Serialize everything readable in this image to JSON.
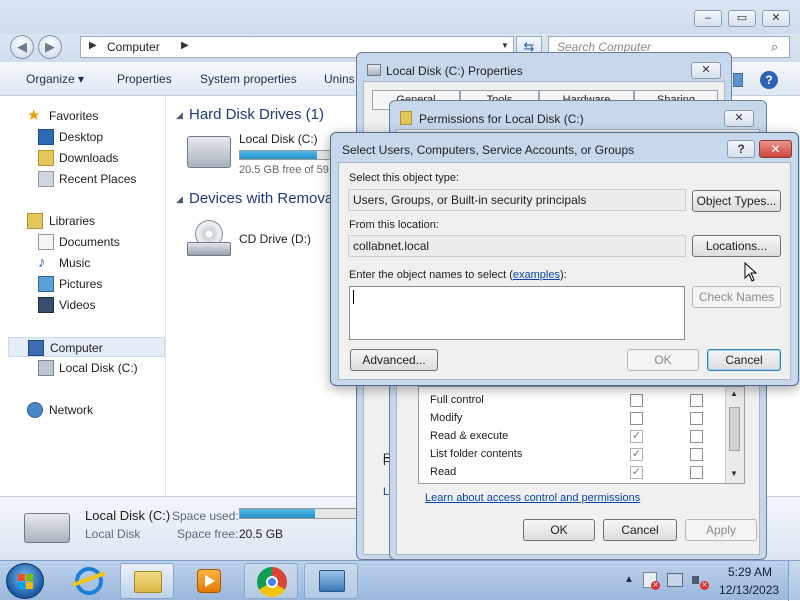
{
  "explorer": {
    "address_path": "Computer",
    "search_placeholder": "Search Computer",
    "toolbar": {
      "organize": "Organize",
      "properties": "Properties",
      "system_properties": "System properties",
      "uninstall": "Unins"
    },
    "sidebar": {
      "favorites": "Favorites",
      "desktop": "Desktop",
      "downloads": "Downloads",
      "recent_places": "Recent Places",
      "libraries": "Libraries",
      "documents": "Documents",
      "music": "Music",
      "pictures": "Pictures",
      "videos": "Videos",
      "computer": "Computer",
      "local_disk": "Local Disk (C:)",
      "network": "Network"
    },
    "main": {
      "hard_disk_header": "Hard Disk Drives (1)",
      "drive_name": "Local Disk (C:)",
      "drive_free": "20.5 GB free of 59",
      "drive_usage_fraction": 0.65,
      "removable_header": "Devices with Remova",
      "cd_drive": "CD Drive (D:)"
    },
    "details": {
      "name": "Local Disk (C:)",
      "type": "Local Disk",
      "space_used_label": "Space used:",
      "space_free_label": "Space free:",
      "space_free_value": "20.5 GB",
      "usage_fraction": 0.65
    }
  },
  "properties_window": {
    "title": "Local Disk (C:) Properties",
    "tabs": [
      "General",
      "Tools",
      "Hardware",
      "Sharing"
    ]
  },
  "permissions_window": {
    "title": "Permissions for Local Disk (C:)",
    "letter_f": "F",
    "letter_l": "L",
    "permissions": [
      {
        "name": "Full control",
        "allow": false,
        "deny": false
      },
      {
        "name": "Modify",
        "allow": false,
        "deny": false
      },
      {
        "name": "Read & execute",
        "allow": true,
        "deny": false
      },
      {
        "name": "List folder contents",
        "allow": true,
        "deny": false
      },
      {
        "name": "Read",
        "allow": true,
        "deny": false
      }
    ],
    "link": "Learn about access control and permissions",
    "ok": "OK",
    "cancel": "Cancel",
    "apply": "Apply"
  },
  "select_dialog": {
    "title": "Select Users, Computers, Service Accounts, or Groups",
    "object_type_label": "Select this object type:",
    "object_type_value": "Users, Groups, or Built-in security principals",
    "object_types_button": "Object Types...",
    "location_label": "From this location:",
    "location_value": "collabnet.local",
    "locations_button": "Locations...",
    "enter_names_prefix": "Enter the object names to select (",
    "examples_link": "examples",
    "enter_names_suffix": "):",
    "object_names_value": "",
    "check_names_button": "Check Names",
    "advanced_button": "Advanced...",
    "ok_button": "OK",
    "cancel_button": "Cancel",
    "help_glyph": "?",
    "close_glyph": "✕"
  },
  "taskbar": {
    "time": "5:29 AM",
    "date": "12/13/2023"
  },
  "colors": {
    "accent": "#1e3a78",
    "link": "#0645ad",
    "drive_bar": "#2aa0d8",
    "close_red": "#c9463d"
  }
}
